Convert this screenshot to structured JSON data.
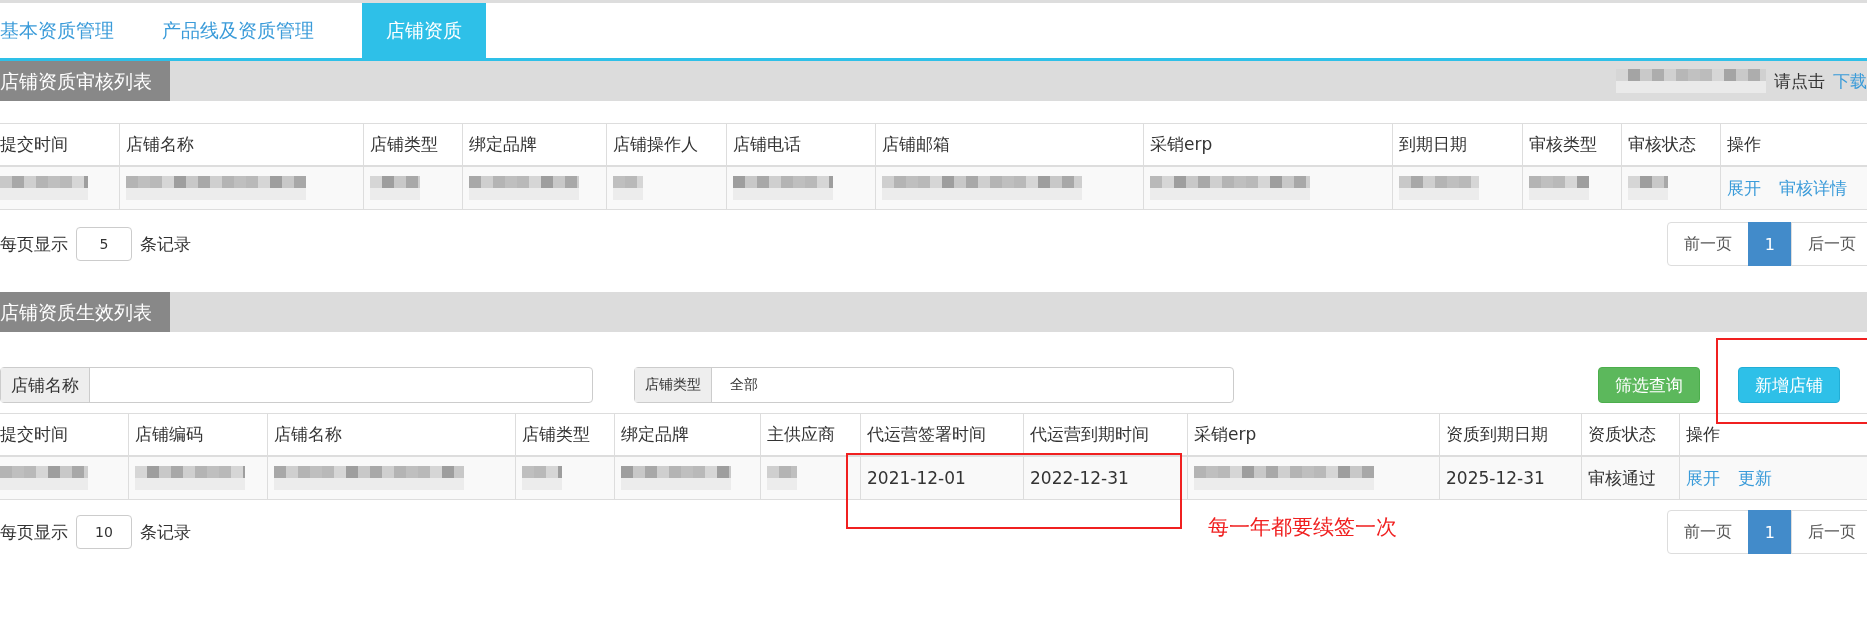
{
  "tabs": [
    {
      "label": "基本资质管理",
      "selected": false
    },
    {
      "label": "产品线及资质管理",
      "selected": false
    },
    {
      "label": "店铺资质",
      "selected": true
    }
  ],
  "review_section": {
    "title": "店铺资质审核列表",
    "download_hint": {
      "prefix": "请点击",
      "link": "下载"
    },
    "table": {
      "columns": [
        "提交时间",
        "店铺名称",
        "店铺类型",
        "绑定品牌",
        "店铺操作人",
        "店铺电话",
        "店铺邮箱",
        "采销erp",
        "到期日期",
        "审核类型",
        "审核状态",
        "操作"
      ],
      "rows": [
        {
          "cells": [
            {
              "kind": "blurred"
            },
            {
              "kind": "blurred"
            },
            {
              "kind": "blurred"
            },
            {
              "kind": "blurred"
            },
            {
              "kind": "blurred"
            },
            {
              "kind": "blurred"
            },
            {
              "kind": "blurred"
            },
            {
              "kind": "blurred"
            },
            {
              "kind": "blurred"
            },
            {
              "kind": "blurred"
            },
            {
              "kind": "blurred"
            },
            {
              "kind": "actions",
              "links": [
                "展开",
                "审核详情"
              ]
            }
          ]
        }
      ]
    },
    "page_size": {
      "label_before": "每页显示",
      "value": "5",
      "label_after": "条记录"
    },
    "pagination": [
      {
        "label": "前一页",
        "selected": false
      },
      {
        "label": "1",
        "selected": true
      },
      {
        "label": "后一页",
        "selected": false
      }
    ]
  },
  "active_section": {
    "title": "店铺资质生效列表",
    "filters": [
      {
        "kind": "text",
        "label": "店铺名称"
      },
      {
        "kind": "select",
        "label": "店铺类型",
        "value": "全部"
      }
    ],
    "buttons": [
      {
        "kind": "filter",
        "label": "筛选查询"
      },
      {
        "kind": "add",
        "label": "新增店铺"
      }
    ],
    "table": {
      "columns": [
        "提交时间",
        "店铺编码",
        "店铺名称",
        "店铺类型",
        "绑定品牌",
        "主供应商",
        "代运营签署时间",
        "代运营到期时间",
        "采销erp",
        "资质到期日期",
        "资质状态",
        "操作"
      ],
      "rows": [
        {
          "cells": [
            {
              "kind": "blurred"
            },
            {
              "kind": "blurred"
            },
            {
              "kind": "blurred"
            },
            {
              "kind": "blurred"
            },
            {
              "kind": "blurred"
            },
            {
              "kind": "blurred"
            },
            {
              "kind": "text",
              "text": "2021-12-01"
            },
            {
              "kind": "text",
              "text": "2022-12-31"
            },
            {
              "kind": "blurred"
            },
            {
              "kind": "text",
              "text": "2025-12-31"
            },
            {
              "kind": "text",
              "text": "审核通过"
            },
            {
              "kind": "actions",
              "links": [
                "展开",
                "更新"
              ]
            }
          ]
        }
      ]
    },
    "page_size": {
      "label_before": "每页显示",
      "value": "10",
      "label_after": "条记录"
    },
    "pagination": [
      {
        "label": "前一页",
        "selected": false
      },
      {
        "label": "1",
        "selected": true
      },
      {
        "label": "后一页",
        "selected": false
      }
    ]
  },
  "annotation": {
    "note": "每一年都要续签一次"
  }
}
